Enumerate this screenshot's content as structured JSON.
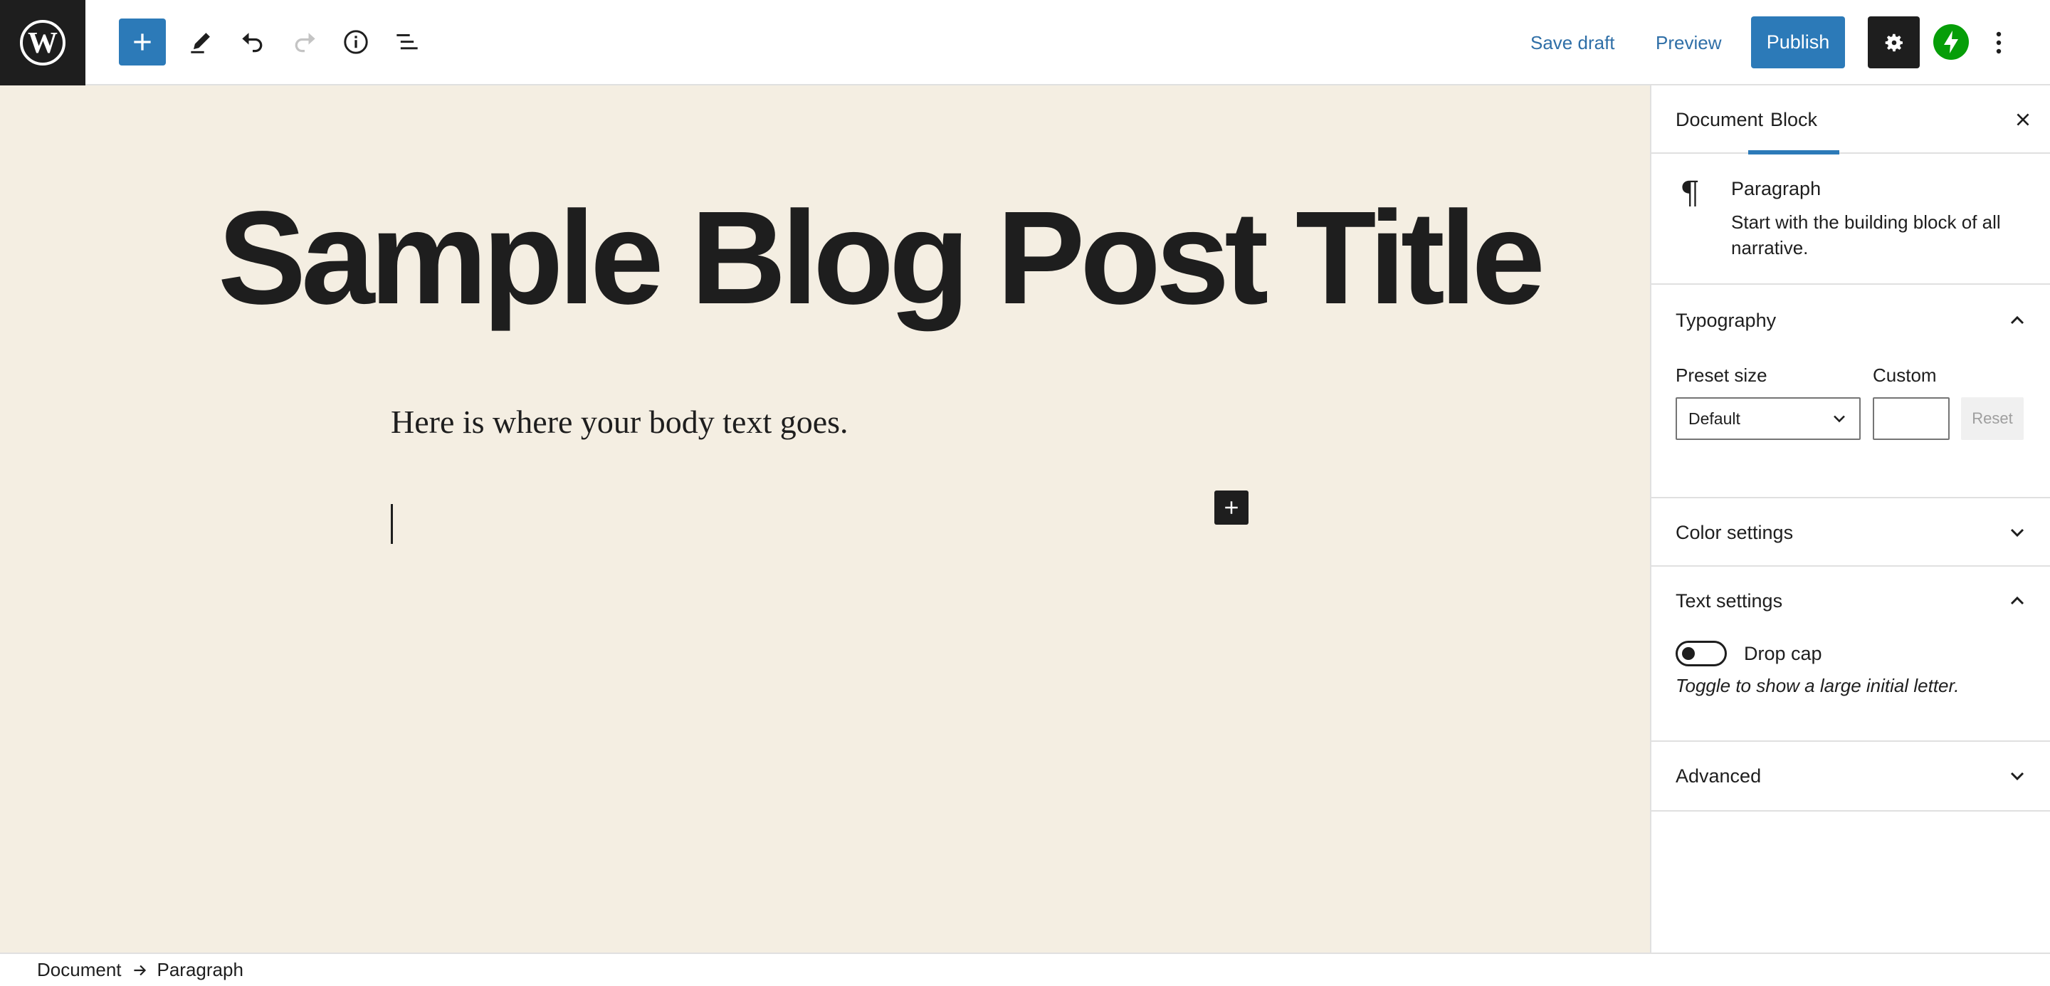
{
  "toolbar": {
    "add_block_icon": "plus-icon",
    "tools_icon": "pencil-icon",
    "undo_icon": "undo-icon",
    "redo_icon": "redo-icon",
    "details_icon": "info-icon",
    "outline_icon": "list-view-icon",
    "save_draft_label": "Save draft",
    "preview_label": "Preview",
    "publish_label": "Publish",
    "settings_icon": "gear-icon",
    "jetpack_icon": "jetpack-icon",
    "more_icon": "more-vertical-icon"
  },
  "canvas": {
    "post_title": "Sample Blog Post Title",
    "body_text": "Here is where your body text goes.",
    "background_color": "#f4eee2"
  },
  "sidebar": {
    "tabs": [
      {
        "label": "Document"
      },
      {
        "label": "Block",
        "active": true
      }
    ],
    "block_card": {
      "icon": "¶",
      "name": "Paragraph",
      "description": "Start with the building block of all narrative."
    },
    "typography": {
      "title": "Typography",
      "expanded": true,
      "preset_size_label": "Preset size",
      "preset_size_value": "Default",
      "custom_label": "Custom",
      "custom_value": "",
      "reset_label": "Reset"
    },
    "color_settings": {
      "title": "Color settings",
      "expanded": false
    },
    "text_settings": {
      "title": "Text settings",
      "expanded": true,
      "drop_cap_label": "Drop cap",
      "drop_cap_enabled": false,
      "drop_cap_help": "Toggle to show a large initial letter."
    },
    "advanced": {
      "title": "Advanced",
      "expanded": false
    }
  },
  "footer": {
    "breadcrumbs": [
      "Document",
      "Paragraph"
    ]
  },
  "colors": {
    "accent": "#2c7ab8",
    "jetpack": "#069e08",
    "dark": "#1e1e1e"
  }
}
